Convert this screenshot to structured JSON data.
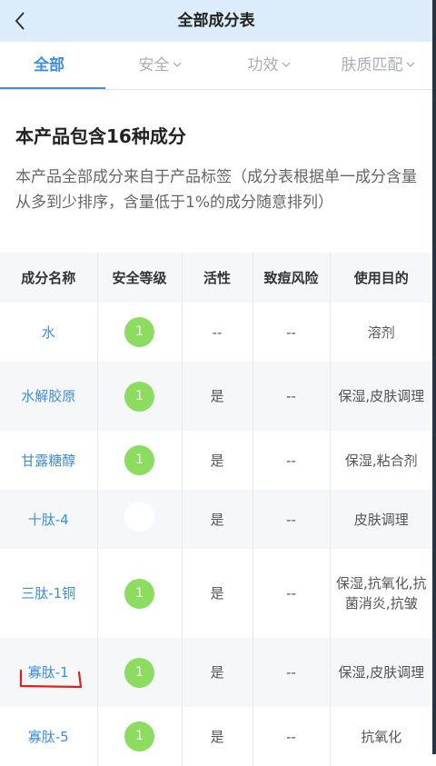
{
  "header": {
    "title": "全部成分表",
    "back_icon": "chevron-left-icon"
  },
  "tabs": [
    {
      "label": "全部",
      "active": true
    },
    {
      "label": "安全",
      "active": false
    },
    {
      "label": "功效",
      "active": false
    },
    {
      "label": "肤质匹配",
      "active": false
    }
  ],
  "summary": {
    "headline": "本产品包含16种成分",
    "description": "本产品全部成分来自于产品标签（成分表根据单一成分含量从多到少排序，含量低于1%的成分随意排列）"
  },
  "table": {
    "columns": [
      "成分名称",
      "安全等级",
      "活性",
      "致痘风险",
      "使用目的"
    ],
    "rows": [
      {
        "name": "水",
        "safety": "1",
        "active": "--",
        "acne": "--",
        "purpose": "溶剂"
      },
      {
        "name": "水解胶原",
        "safety": "1",
        "active": "是",
        "acne": "--",
        "purpose": "保湿,皮肤调理"
      },
      {
        "name": "甘露糖醇",
        "safety": "1",
        "active": "是",
        "acne": "--",
        "purpose": "保湿,粘合剂"
      },
      {
        "name": "十肽-4",
        "safety": "",
        "active": "是",
        "acne": "--",
        "purpose": "皮肤调理"
      },
      {
        "name": "三肽-1铜",
        "safety": "1",
        "active": "是",
        "acne": "--",
        "purpose": "保湿,抗氧化,抗菌消炎,抗皱"
      },
      {
        "name": "寡肽-1",
        "safety": "1",
        "active": "是",
        "acne": "--",
        "purpose": "保湿,皮肤调理"
      },
      {
        "name": "寡肽-5",
        "safety": "1",
        "active": "是",
        "acne": "--",
        "purpose": "抗氧化"
      }
    ]
  },
  "colors": {
    "accent": "#3d8ee0",
    "badge": "#8cdc5f",
    "header_bg": "#dcecfb",
    "annotation": "#e02020"
  }
}
